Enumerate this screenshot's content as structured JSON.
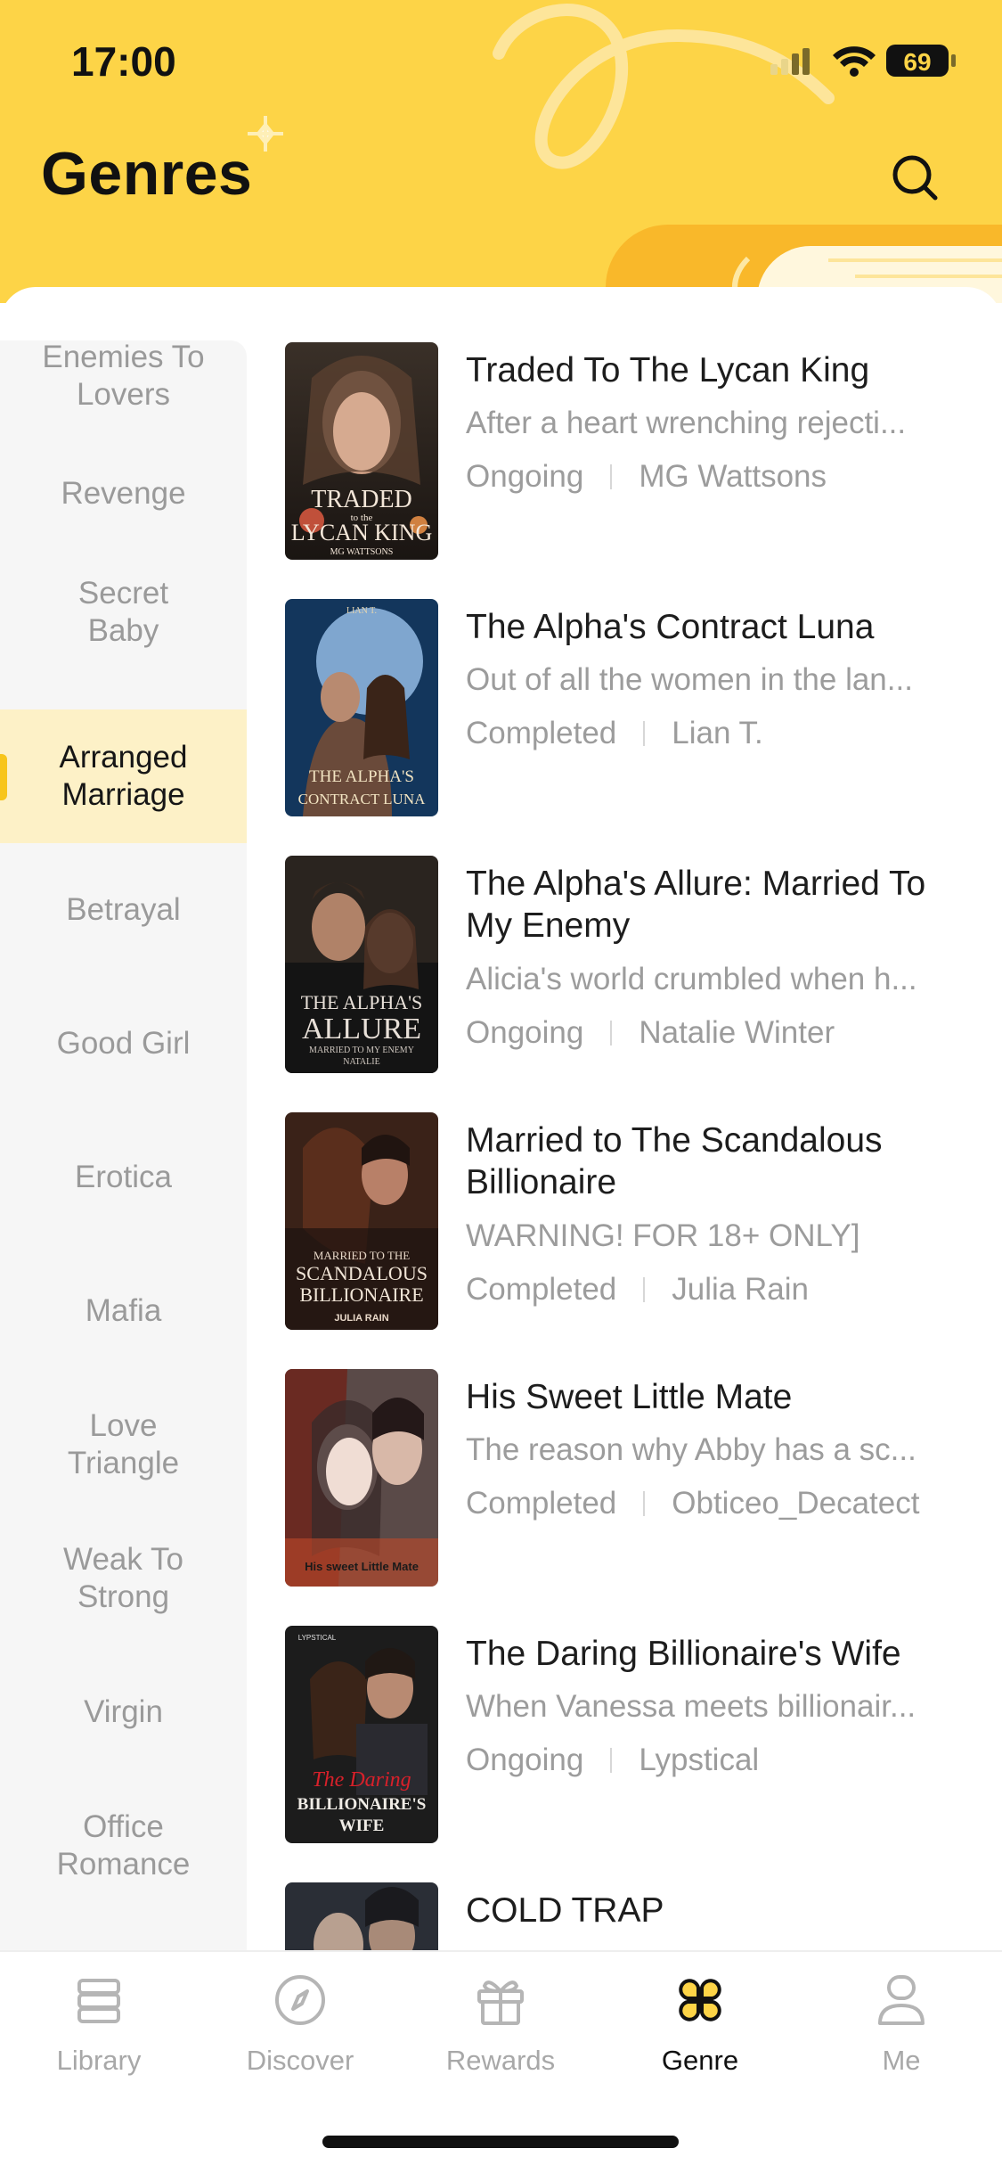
{
  "status_bar": {
    "time": "17:00",
    "battery": "69"
  },
  "header": {
    "title": "Genres"
  },
  "genres": [
    {
      "label": "Enemies To Lovers",
      "active": false
    },
    {
      "label": "Revenge",
      "active": false
    },
    {
      "label": "Secret Baby",
      "active": false
    },
    {
      "label": "Arranged Marriage",
      "active": true
    },
    {
      "label": "Betrayal",
      "active": false
    },
    {
      "label": "Good Girl",
      "active": false
    },
    {
      "label": "Erotica",
      "active": false
    },
    {
      "label": "Mafia",
      "active": false
    },
    {
      "label": "Love Triangle",
      "active": false
    },
    {
      "label": "Weak To Strong",
      "active": false
    },
    {
      "label": "Virgin",
      "active": false
    },
    {
      "label": "Office Romance",
      "active": false
    }
  ],
  "books": [
    {
      "title": "Traded To The Lycan King",
      "description": "After a heart wrenching rejecti...",
      "status": "Ongoing",
      "author": "MG Wattsons",
      "cover_text": [
        "TRADED",
        "to the",
        "LYCAN KING",
        "MG WATTSONS"
      ]
    },
    {
      "title": "The Alpha's Contract Luna",
      "description": "Out of all the women in the lan...",
      "status": "Completed",
      "author": "Lian T.",
      "cover_text": [
        "LIAN T.",
        "THE ALPHA'S",
        "CONTRACT LUNA"
      ]
    },
    {
      "title": "The Alpha's Allure: Married To My Enemy",
      "description": "Alicia's world crumbled when h...",
      "status": "Ongoing",
      "author": "Natalie Winter",
      "cover_text": [
        "THE ALPHA'S",
        "ALLURE",
        "MARRIED TO MY ENEMY",
        "NATALIE"
      ]
    },
    {
      "title": "Married to The Scandalous Billionaire",
      "description": "WARNING! FOR 18+ ONLY]",
      "status": "Completed",
      "author": "Julia Rain",
      "cover_text": [
        "MARRIED TO THE",
        "SCANDALOUS",
        "BILLIONAIRE",
        "JULIA RAIN"
      ]
    },
    {
      "title": "His Sweet Little Mate",
      "description": "The reason why Abby has a sc...",
      "status": "Completed",
      "author": "Obticeo_Decatect",
      "cover_text": [
        "His sweet Little Mate"
      ]
    },
    {
      "title": "The Daring Billionaire's Wife",
      "description": "When Vanessa meets billionair...",
      "status": "Ongoing",
      "author": "Lypstical",
      "cover_text": [
        "LYPSTICAL",
        "The Daring",
        "BILLIONAIRE'S",
        "WIFE"
      ]
    },
    {
      "title": "COLD TRAP",
      "description": "",
      "status": "",
      "author": "",
      "cover_text": []
    }
  ],
  "tabs": [
    {
      "label": "Library",
      "icon": "library-icon",
      "active": false
    },
    {
      "label": "Discover",
      "icon": "compass-icon",
      "active": false
    },
    {
      "label": "Rewards",
      "icon": "gift-icon",
      "active": false
    },
    {
      "label": "Genre",
      "icon": "clover-icon",
      "active": true
    },
    {
      "label": "Me",
      "icon": "person-icon",
      "active": false
    }
  ],
  "colors": {
    "accent": "#fdd447",
    "active_genre_bg": "#fdf1c7",
    "marker": "#f7c51b"
  }
}
